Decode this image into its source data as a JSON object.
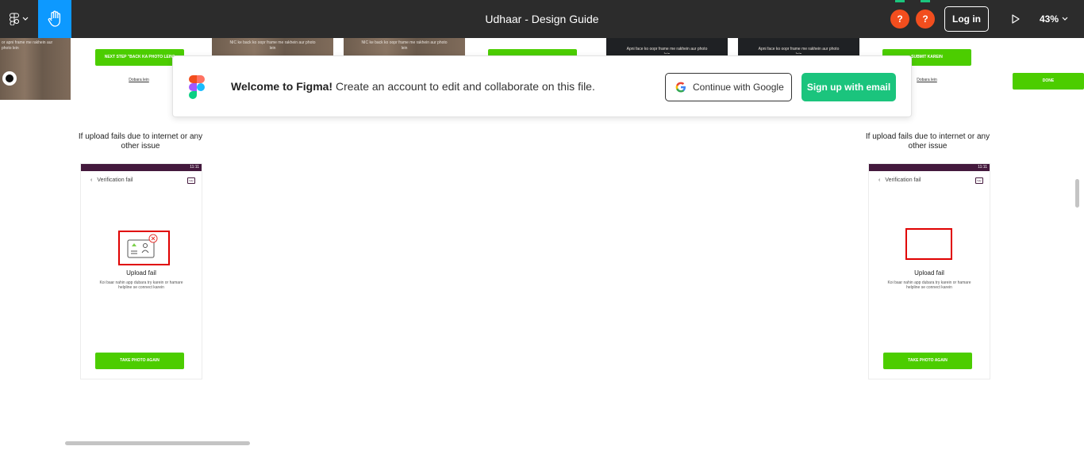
{
  "topbar": {
    "title": "Udhaar - Design Guide",
    "avatars": [
      "?",
      "?"
    ],
    "login_label": "Log in",
    "zoom": "43%",
    "accent": "#0d99ff",
    "avatar_color": "#f24e1e"
  },
  "banner": {
    "welcome_bold": "Welcome to Figma!",
    "welcome_rest": " Create an account to edit and collaborate on this file.",
    "google_label": "Continue with Google",
    "email_label": "Sign up with email",
    "email_color": "#1bc47d"
  },
  "top_frames": {
    "frame1_text": "or apni frame me rakhein aur photo lein",
    "frame2_text": "NIC ke back ko oopr frame me rakhein aur photo lein",
    "frame3_text": "NIC ke back ko oopr frame me rakhein aur photo lein",
    "frame4_text": "Apni face ko oopr frame me rakhein aur photo lein",
    "frame5_text": "Apni face ko oopr frame me rakhein aur photo lein",
    "next_step_btn": "NEXT STEP \"BACK KA PHOTO LEIN\"",
    "dobara_1": "Dobara lein",
    "submit_btn": "SUBMIT KAREIN",
    "dobara_2": "Dobara lein",
    "done_btn": "DONE",
    "green": "#4ccd00"
  },
  "left_screen": {
    "caption": "If upload fails due to internet or any other issue",
    "time": "11:11",
    "header": "Verification fail",
    "help": "help",
    "title": "Upload fail",
    "desc": "Koi baar nahin app dubara try karein or hamare helpline se connect karein",
    "button": "TAKE PHOTO AGAIN"
  },
  "right_screen": {
    "caption": "If upload fails due to internet or any other issue",
    "time": "11:11",
    "header": "Verification fail",
    "help": "help",
    "title": "Upload fail",
    "desc": "Koi baar nahin app dubara try karein or hamare helpline se connect karein",
    "button": "TAKE PHOTO AGAIN"
  }
}
